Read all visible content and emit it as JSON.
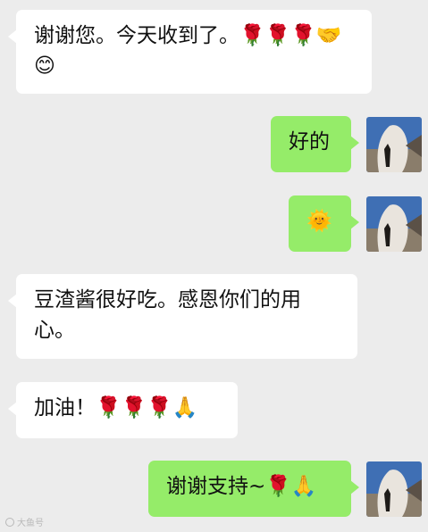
{
  "messages": [
    {
      "sender": "other",
      "text": "谢谢您。今天收到了。🌹🌹🌹🤝😊"
    },
    {
      "sender": "me",
      "text": "好的"
    },
    {
      "sender": "me",
      "text": "🌞"
    },
    {
      "sender": "other",
      "text": "豆渣酱很好吃。感恩你们的用心。"
    },
    {
      "sender": "other",
      "text": "加油！🌹🌹🌹🙏"
    },
    {
      "sender": "me",
      "text": "谢谢支持~🌹🙏"
    }
  ],
  "watermark": {
    "text": "大鱼号"
  },
  "colors": {
    "background": "#ececec",
    "incoming_bubble": "#ffffff",
    "outgoing_bubble": "#95ec69"
  }
}
